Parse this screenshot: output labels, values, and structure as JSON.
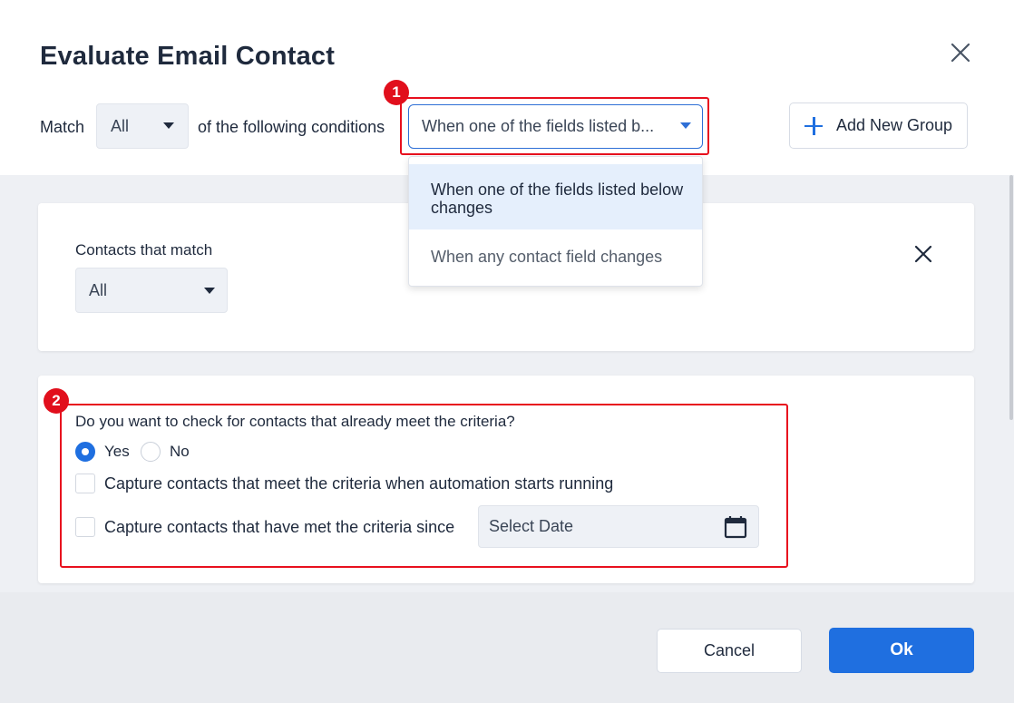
{
  "dialog": {
    "title": "Evaluate Email Contact"
  },
  "conditions": {
    "match_label": "Match",
    "match_value": "All",
    "following_label": "of the following conditions",
    "trigger_value": "When one of the fields listed b...",
    "trigger_options": [
      "When one of the fields listed below changes",
      "When any contact field changes"
    ],
    "add_group_label": "Add New Group"
  },
  "group": {
    "contacts_label": "Contacts that match",
    "contacts_value": "All"
  },
  "existing_check": {
    "question": "Do you want to check for contacts that already meet the criteria?",
    "yes_label": "Yes",
    "no_label": "No",
    "selected": "Yes",
    "capture_on_start_label": "Capture contacts that meet the criteria when automation starts running",
    "capture_since_label": "Capture contacts that have met the criteria since",
    "date_placeholder": "Select Date"
  },
  "annotations": {
    "badge_1": "1",
    "badge_2": "2"
  },
  "footer": {
    "cancel_label": "Cancel",
    "ok_label": "Ok"
  },
  "colors": {
    "accent": "#1f6fe0",
    "highlight_red": "#e8101e",
    "selected_option_bg": "#e5effc"
  },
  "icons": [
    "close-icon",
    "chevron-down-icon",
    "plus-icon",
    "calendar-icon"
  ]
}
